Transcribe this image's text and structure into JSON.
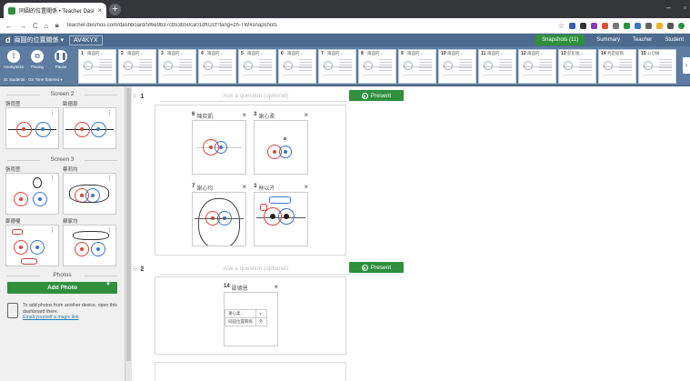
{
  "browser": {
    "tab_title": "同圓的位置關係 • Teacher Dash",
    "url": "teacher.desmos.com/dashboard/5f6e9b37cb53b50ca01df02cf?lang=zh-TW#snapshots"
  },
  "header": {
    "logo": "d",
    "title": "兩圓的位置關係 ▾",
    "class_code": "AV4KYX",
    "tabs": [
      "Snapshots (11)",
      "Summary",
      "Teacher",
      "Student"
    ]
  },
  "toolbar": {
    "tools": [
      {
        "label": "Anonymize",
        "icon": "⇧"
      },
      {
        "label": "Pacing",
        "icon": "⧉"
      },
      {
        "label": "Pause",
        "icon": "❚❚"
      }
    ],
    "students": "31 students  ·  Go Time Entered ▾",
    "screens": [
      {
        "num": "1",
        "name": "兩圓的..."
      },
      {
        "num": "2",
        "name": "兩圓的..."
      },
      {
        "num": "3",
        "name": "兩圓的..."
      },
      {
        "num": "4",
        "name": "兩圓的..."
      },
      {
        "num": "5",
        "name": "兩圓的..."
      },
      {
        "num": "6",
        "name": "兩圓的..."
      },
      {
        "num": "7",
        "name": "兩圓的..."
      },
      {
        "num": "8",
        "name": "兩圓的..."
      },
      {
        "num": "9",
        "name": "兩圓的..."
      },
      {
        "num": "10",
        "name": "兩圓的..."
      },
      {
        "num": "11",
        "name": "兩圓的..."
      },
      {
        "num": "12",
        "name": "兩圓的..."
      },
      {
        "num": "13",
        "name": "彭彭福..."
      },
      {
        "num": "14",
        "name": "判定結目"
      },
      {
        "num": "15",
        "name": "公切線"
      }
    ]
  },
  "sidebar": {
    "screen2": {
      "heading": "Screen 2",
      "names": [
        "張雨萱",
        "歐德恩"
      ]
    },
    "screen3": {
      "heading": "Screen 3",
      "names": [
        "張雨萱",
        "蔡莉均",
        "鄭德權",
        "蘇家均"
      ]
    },
    "photos": {
      "heading": "Photos",
      "add_label": "Add Photo",
      "hint": "To add photos from another device, open this dashboard there.",
      "link": "Email yourself a magic link"
    }
  },
  "questions": [
    {
      "num": "1",
      "placeholder": "Ask a question (optional)",
      "present_label": "Present"
    },
    {
      "num": "2",
      "placeholder": "Ask a question (optional)",
      "present_label": "Present"
    }
  ],
  "q1_snapshots": [
    {
      "num": "6",
      "name": "陳奕凱"
    },
    {
      "num": "3",
      "name": "謝心柔"
    },
    {
      "num": "7",
      "name": "謝心均"
    },
    {
      "num": "3",
      "name": "林以卉"
    }
  ],
  "q2_snapshot": {
    "num": "14",
    "name": "歐德恩",
    "table": [
      [
        "謝心柔...",
        "7"
      ],
      [
        "同圓位置關係",
        "外"
      ]
    ]
  },
  "colors": {
    "accent": "#2f8f3d",
    "header": "#4c6a8e",
    "red_circle": "#d9453d",
    "blue_circle": "#3a76c4"
  }
}
